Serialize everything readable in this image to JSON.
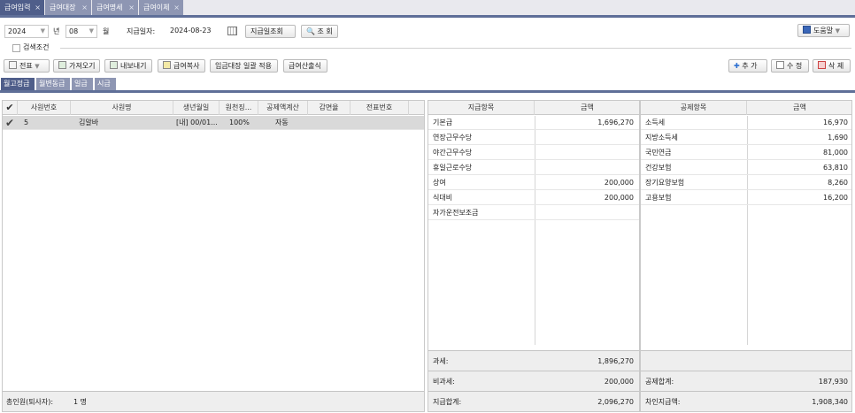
{
  "tabs": [
    {
      "label": "급여입력"
    },
    {
      "label": "급여대장"
    },
    {
      "label": "급여명세"
    },
    {
      "label": "급여이체"
    }
  ],
  "tab_close": "×",
  "filter": {
    "year": "2024",
    "year_unit": "년",
    "month": "08",
    "month_unit": "월",
    "pay_date_label": "지급일자:",
    "pay_date": "2024-08-23",
    "pay_date_lookup_label": "지급일조회",
    "search_label": "조 회",
    "help_label": "도움말"
  },
  "search_condition_label": "검색조건",
  "toolbar": {
    "voucher": "전표",
    "import": "가져오기",
    "export": "내보내기",
    "copy_pay": "급여복사",
    "bulk_apply": "임금대장 일괄 적용",
    "calc": "급여산출식",
    "add": "추 가",
    "edit": "수 정",
    "delete": "삭 제"
  },
  "subtabs": [
    "월고정급",
    "월변동급",
    "일급",
    "시급"
  ],
  "employee_table": {
    "columns": [
      "사원번호",
      "사원명",
      "생년월일",
      "원천징...",
      "공제액계산",
      "감면율",
      "전표번호"
    ],
    "rows": [
      {
        "id": "5",
        "name": "김알바",
        "birth": "[내] 00/01...",
        "withholding": "100%",
        "deduction_calc": "자동",
        "reduction": "",
        "voucher": ""
      }
    ],
    "footer_label": "총인원(퇴사자):",
    "footer_value": "1 명"
  },
  "pay_table": {
    "columns": [
      "지급항목",
      "금액"
    ],
    "rows": [
      {
        "item": "기본급",
        "amount": "1,696,270"
      },
      {
        "item": "연장근무수당",
        "amount": ""
      },
      {
        "item": "야간근무수당",
        "amount": ""
      },
      {
        "item": "휴일근로수당",
        "amount": ""
      },
      {
        "item": "상여",
        "amount": "200,000"
      },
      {
        "item": "식대비",
        "amount": "200,000"
      },
      {
        "item": "자가운전보조금",
        "amount": ""
      }
    ],
    "taxable_label": "과세:",
    "taxable_value": "1,896,270",
    "nontaxable_label": "비과세:",
    "nontaxable_value": "200,000",
    "total_label": "지급합계:",
    "total_value": "2,096,270"
  },
  "deduct_table": {
    "columns": [
      "공제항목",
      "금액"
    ],
    "rows": [
      {
        "item": "소득세",
        "amount": "16,970"
      },
      {
        "item": "지방소득세",
        "amount": "1,690"
      },
      {
        "item": "국민연금",
        "amount": "81,000"
      },
      {
        "item": "건강보험",
        "amount": "63,810"
      },
      {
        "item": "장기요양보험",
        "amount": "8,260"
      },
      {
        "item": "고용보험",
        "amount": "16,200"
      }
    ],
    "total_label": "공제합계:",
    "total_value": "187,930",
    "net_label": "차인지급액:",
    "net_value": "1,908,340"
  },
  "colors": {
    "tab_active": "#4f5e8a",
    "tab_inactive": "#8e96b3",
    "accent_bar": "#5f6f98",
    "row_selected": "#d9d9d9"
  }
}
